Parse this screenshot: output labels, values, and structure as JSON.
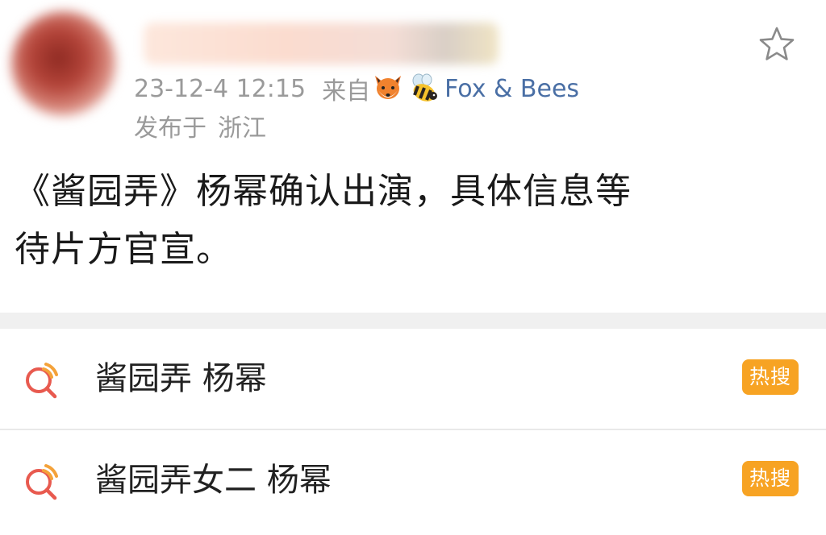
{
  "post": {
    "timestamp": "23-12-4 12:15",
    "from_label": "来自",
    "source_icons": [
      "fox-emoji",
      "bee-emoji"
    ],
    "source_name": "Fox & Bees",
    "location_label": "发布于",
    "location": "浙江",
    "body_line1": "《酱园弄》杨幂确认出演，具体信息等",
    "body_line2": "待片方官宣。"
  },
  "hot_searches": [
    {
      "text": "酱园弄 杨幂",
      "badge": "热搜"
    },
    {
      "text": "酱园弄女二 杨幂",
      "badge": "热搜"
    }
  ],
  "colors": {
    "meta_gray": "#9a9a9a",
    "link_blue": "#4a6fa5",
    "badge_orange": "#f7a323",
    "search_icon_red": "#e85a4f",
    "search_icon_orange": "#f4a23a",
    "divider_gray": "#f0f0f0"
  }
}
